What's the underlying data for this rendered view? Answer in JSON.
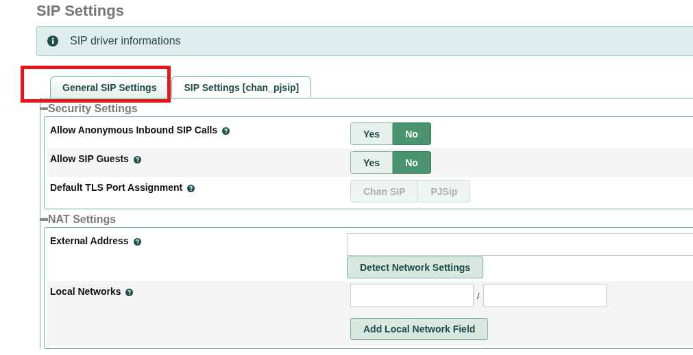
{
  "page": {
    "title": "SIP Settings"
  },
  "info_box": {
    "text": "SIP driver informations"
  },
  "tabs": [
    {
      "label": "General SIP Settings",
      "selected": true,
      "highlighted": true
    },
    {
      "label": "SIP Settings [chan_pjsip]",
      "selected": false,
      "highlighted": false
    }
  ],
  "sections": [
    {
      "title": "Security Settings",
      "expanded": true,
      "rows": [
        {
          "kind": "toggle",
          "label": "Allow Anonymous Inbound SIP Calls",
          "disabled": false,
          "options": [
            {
              "label": "Yes",
              "selected": false
            },
            {
              "label": "No",
              "selected": true
            }
          ]
        },
        {
          "kind": "toggle",
          "label": "Allow SIP Guests",
          "disabled": false,
          "options": [
            {
              "label": "Yes",
              "selected": false
            },
            {
              "label": "No",
              "selected": true
            }
          ]
        },
        {
          "kind": "toggle",
          "label": "Default TLS Port Assignment",
          "disabled": true,
          "options": [
            {
              "label": "Chan SIP",
              "selected": false
            },
            {
              "label": "PJSip",
              "selected": false
            }
          ]
        }
      ]
    },
    {
      "title": "NAT Settings",
      "expanded": true,
      "rows": [
        {
          "kind": "input-button",
          "label": "External Address",
          "button": "Detect Network Settings"
        },
        {
          "kind": "network",
          "label": "Local Networks",
          "separator": "/",
          "button": "Add Local Network Field"
        }
      ]
    }
  ]
}
